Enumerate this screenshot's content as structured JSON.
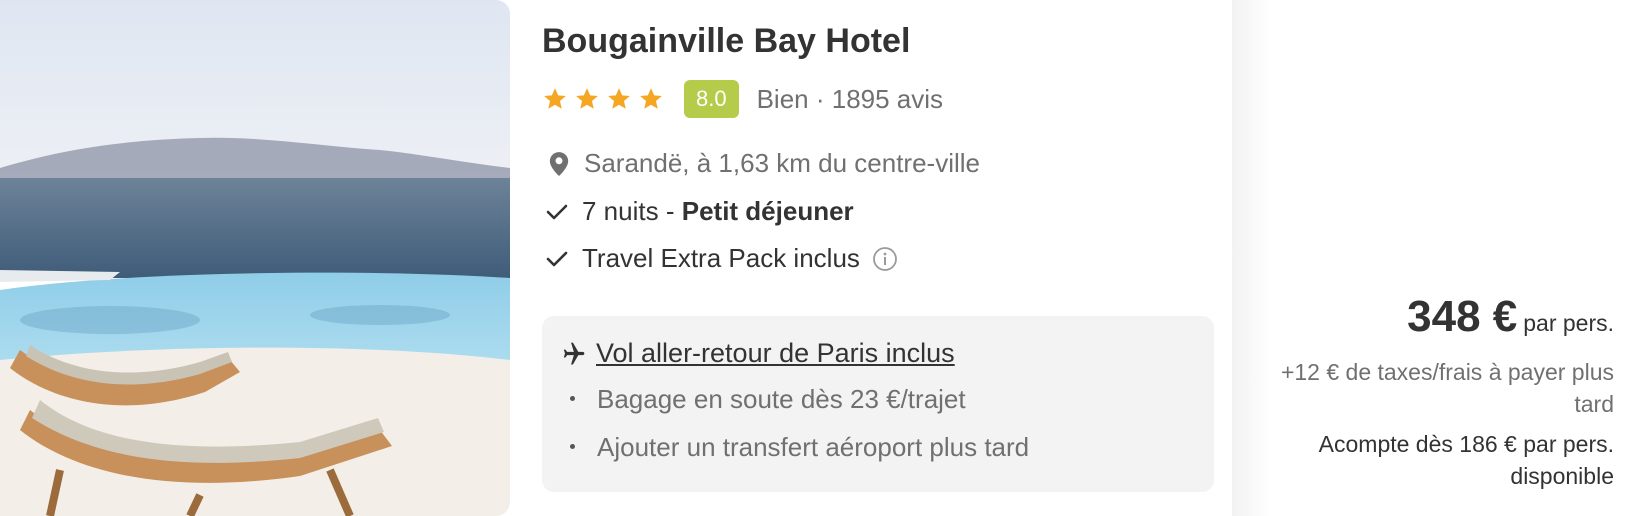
{
  "hotel": {
    "name": "Bougainville Bay Hotel",
    "stars": 4,
    "score": "8.0",
    "rating_label": "Bien · 1895 avis",
    "location": "Sarandë, à 1,63 km du centre-ville"
  },
  "features": {
    "stay_prefix": "7 nuits - ",
    "stay_board": "Petit déjeuner",
    "pack": "Travel Extra Pack inclus"
  },
  "flight": {
    "heading": "Vol aller-retour de Paris inclus",
    "bullets": [
      "Bagage en soute dès 23 €/trajet",
      "Ajouter un transfert aéroport plus tard"
    ]
  },
  "pricing": {
    "price": "348 €",
    "per": "par pers.",
    "taxes": "+12 € de taxes/frais à payer plus tard",
    "deposit": "Acompte dès 186 € par pers. disponible"
  },
  "colors": {
    "score_badge": "#b5cc4a",
    "star": "#f5a623",
    "text_main": "#333333",
    "text_muted": "#707070",
    "box_bg": "#f3f3f3"
  },
  "icons": [
    "star-icon",
    "location-pin-icon",
    "check-icon",
    "info-icon",
    "airplane-icon"
  ]
}
